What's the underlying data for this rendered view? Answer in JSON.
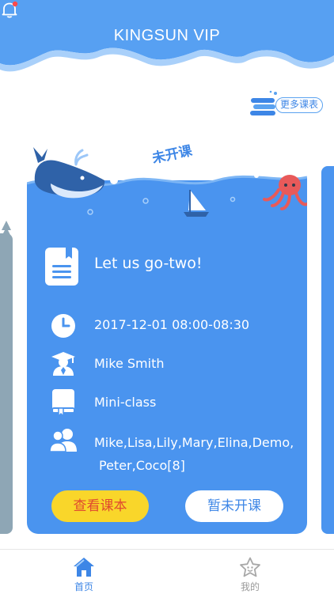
{
  "header": {
    "title": "KINGSUN VIP",
    "notification_icon": "bell-icon",
    "has_unread": true
  },
  "more_courses": {
    "label": "更多课表",
    "icon": "book-stack-icon"
  },
  "card": {
    "status": "未开课",
    "course_title": "Let us go-two!",
    "time": "2017-12-01   08:00-08:30",
    "teacher": "Mike Smith",
    "class_type": "Mini-class",
    "students_line1": "Mike,Lisa,Lily,Mary,Elina,Demo,",
    "students_line2": "Peter,Coco[8]",
    "icons": [
      "document-icon",
      "clock-icon",
      "teacher-icon",
      "book-icon",
      "students-icon"
    ],
    "view_button": "查看课本",
    "status_button": "暂未开课"
  },
  "tabbar": {
    "home": "首页",
    "mine": "我的"
  },
  "colors": {
    "primary": "#4a94ef",
    "accent_yellow": "#f9d62a",
    "accent_red": "#e04a2f",
    "notification_dot": "#ff4a4a"
  }
}
